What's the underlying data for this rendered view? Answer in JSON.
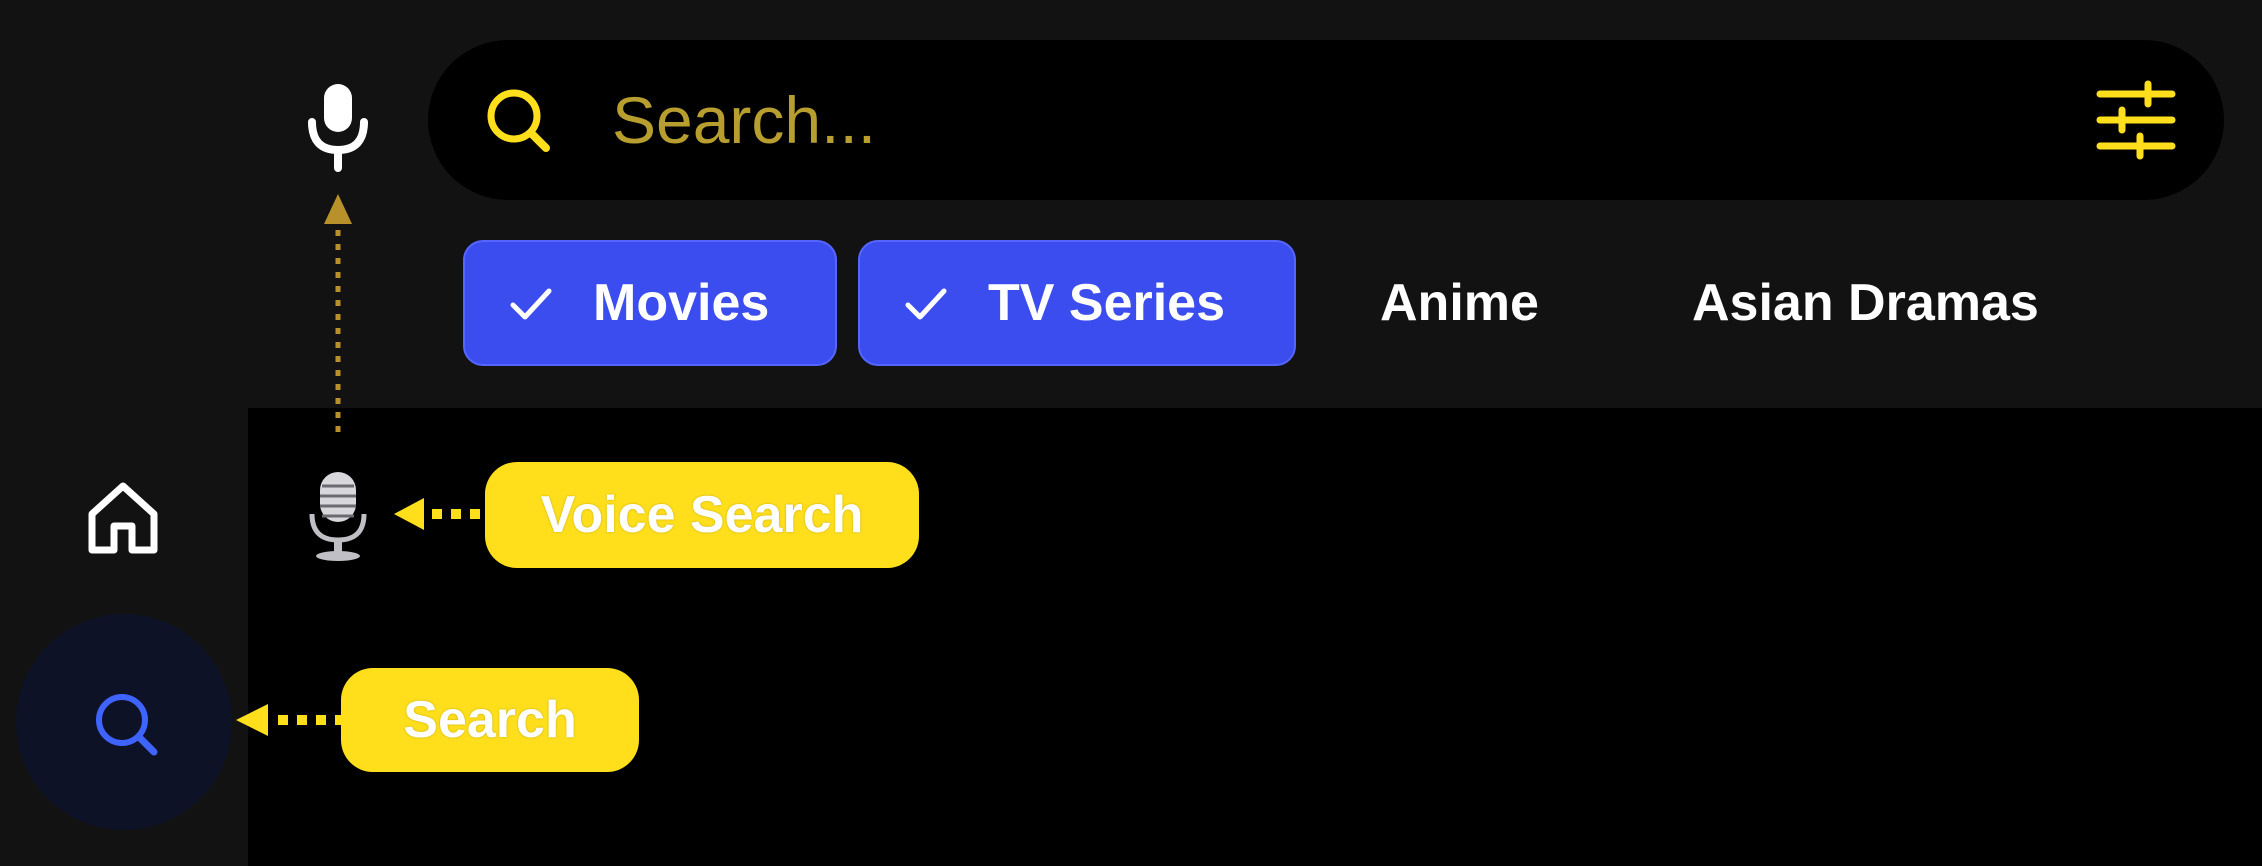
{
  "search": {
    "placeholder": "Search..."
  },
  "categories": [
    {
      "label": "Movies",
      "selected": true
    },
    {
      "label": "TV Series",
      "selected": true
    },
    {
      "label": "Anime",
      "selected": false
    },
    {
      "label": "Asian Dramas",
      "selected": false
    }
  ],
  "callouts": {
    "voice_search": "Voice Search",
    "search": "Search"
  },
  "icons": {
    "mic": "microphone-icon",
    "search": "search-icon",
    "filter": "sliders-icon",
    "check": "check-icon",
    "home": "home-icon",
    "studio_mic": "studio-microphone-icon"
  },
  "colors": {
    "accent_yellow": "#ffdf1c",
    "chip_blue": "#3c4df0",
    "nav_search_blue": "#3f63ff",
    "placeholder": "#b79e2e"
  }
}
